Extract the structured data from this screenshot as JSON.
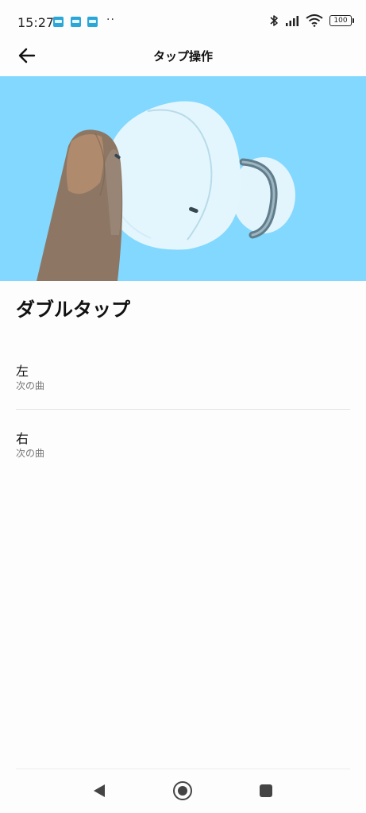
{
  "status_bar": {
    "time": "15:27",
    "dots": "··",
    "battery": "100",
    "icons": [
      "notification-app-icon",
      "notification-app-icon",
      "notification-app-icon",
      "bluetooth-icon",
      "signal-icon",
      "wifi-icon",
      "battery-icon"
    ]
  },
  "header": {
    "title": "タップ操作",
    "back_icon": "back-arrow-icon"
  },
  "hero": {
    "image": "finger-tapping-earbud-illustration",
    "background_color": "#82d8fe"
  },
  "section": {
    "title": "ダブルタップ"
  },
  "settings": [
    {
      "label": "左",
      "value": "次の曲"
    },
    {
      "label": "右",
      "value": "次の曲"
    }
  ],
  "nav": {
    "icons": [
      "back-triangle-icon",
      "home-circle-icon",
      "recents-square-icon"
    ]
  }
}
